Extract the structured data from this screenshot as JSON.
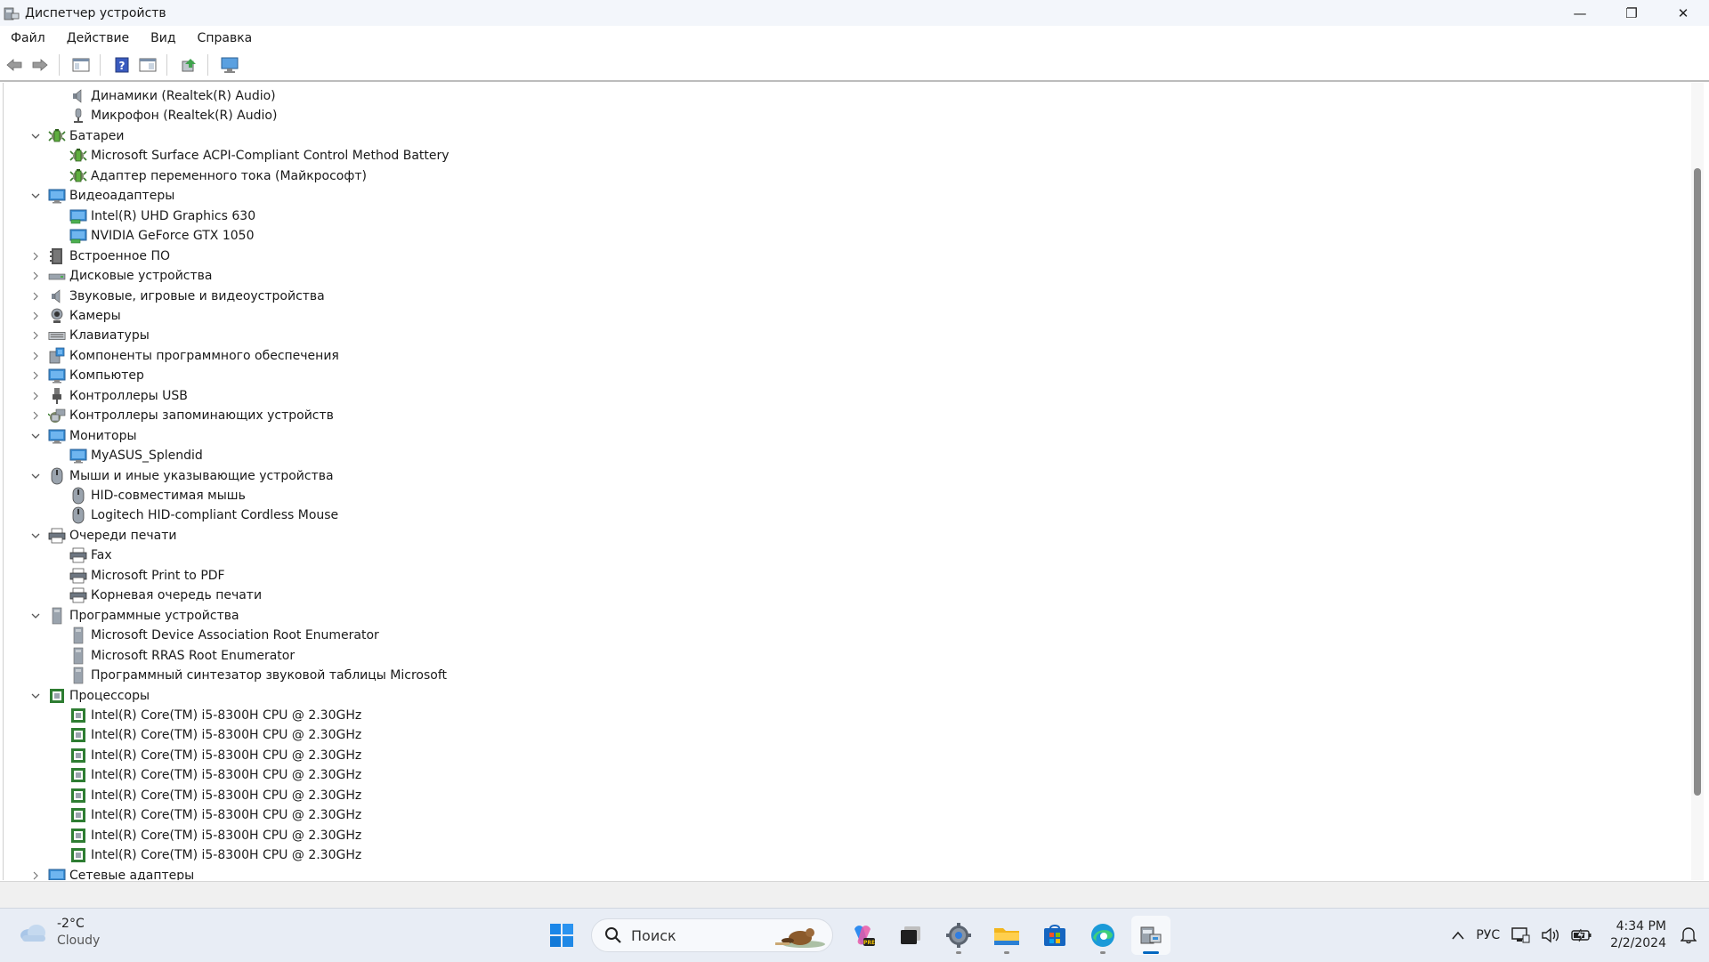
{
  "window": {
    "title": "Диспетчер устройств",
    "controls": {
      "minimize": "—",
      "maximize": "❐",
      "close": "✕"
    }
  },
  "menu": [
    "Файл",
    "Действие",
    "Вид",
    "Справка"
  ],
  "tree": [
    {
      "label": "Динамики (Realtek(R) Audio)",
      "level": 2,
      "icon": "speaker"
    },
    {
      "label": "Микрофон (Realtek(R) Audio)",
      "level": 2,
      "icon": "microphone"
    },
    {
      "label": "Батареи",
      "level": 1,
      "icon": "battery",
      "expanded": true
    },
    {
      "label": "Microsoft Surface ACPI-Compliant Control Method Battery",
      "level": 2,
      "icon": "battery"
    },
    {
      "label": "Адаптер переменного тока (Майкрософт)",
      "level": 2,
      "icon": "battery"
    },
    {
      "label": "Видеоадаптеры",
      "level": 1,
      "icon": "monitor",
      "expanded": true
    },
    {
      "label": "Intel(R) UHD Graphics 630",
      "level": 2,
      "icon": "display-adapter"
    },
    {
      "label": "NVIDIA GeForce GTX 1050",
      "level": 2,
      "icon": "display-adapter"
    },
    {
      "label": "Встроенное ПО",
      "level": 1,
      "icon": "firmware",
      "expanded": false
    },
    {
      "label": "Дисковые устройства",
      "level": 1,
      "icon": "disk",
      "expanded": false
    },
    {
      "label": "Звуковые, игровые и видеоустройства",
      "level": 1,
      "icon": "speaker",
      "expanded": false
    },
    {
      "label": "Камеры",
      "level": 1,
      "icon": "camera",
      "expanded": false
    },
    {
      "label": "Клавиатуры",
      "level": 1,
      "icon": "keyboard",
      "expanded": false
    },
    {
      "label": "Компоненты программного обеспечения",
      "level": 1,
      "icon": "software",
      "expanded": false
    },
    {
      "label": "Компьютер",
      "level": 1,
      "icon": "monitor",
      "expanded": false
    },
    {
      "label": "Контроллеры USB",
      "level": 1,
      "icon": "usb",
      "expanded": false
    },
    {
      "label": "Контроллеры запоминающих устройств",
      "level": 1,
      "icon": "storage",
      "expanded": false
    },
    {
      "label": "Мониторы",
      "level": 1,
      "icon": "monitor",
      "expanded": true
    },
    {
      "label": "MyASUS_Splendid",
      "level": 2,
      "icon": "monitor"
    },
    {
      "label": "Мыши и иные указывающие устройства",
      "level": 1,
      "icon": "mouse",
      "expanded": true
    },
    {
      "label": "HID-совместимая мышь",
      "level": 2,
      "icon": "mouse"
    },
    {
      "label": "Logitech HID-compliant Cordless Mouse",
      "level": 2,
      "icon": "mouse"
    },
    {
      "label": "Очереди печати",
      "level": 1,
      "icon": "printer",
      "expanded": true
    },
    {
      "label": "Fax",
      "level": 2,
      "icon": "printer"
    },
    {
      "label": "Microsoft Print to PDF",
      "level": 2,
      "icon": "printer"
    },
    {
      "label": "Корневая очередь печати",
      "level": 2,
      "icon": "printer"
    },
    {
      "label": "Программные устройства",
      "level": 1,
      "icon": "software-device",
      "expanded": true
    },
    {
      "label": "Microsoft Device Association Root Enumerator",
      "level": 2,
      "icon": "software-device"
    },
    {
      "label": "Microsoft RRAS Root Enumerator",
      "level": 2,
      "icon": "software-device"
    },
    {
      "label": "Программный синтезатор звуковой таблицы Microsoft",
      "level": 2,
      "icon": "software-device"
    },
    {
      "label": "Процессоры",
      "level": 1,
      "icon": "cpu",
      "expanded": true
    },
    {
      "label": "Intel(R) Core(TM) i5-8300H CPU @ 2.30GHz",
      "level": 2,
      "icon": "cpu"
    },
    {
      "label": "Intel(R) Core(TM) i5-8300H CPU @ 2.30GHz",
      "level": 2,
      "icon": "cpu"
    },
    {
      "label": "Intel(R) Core(TM) i5-8300H CPU @ 2.30GHz",
      "level": 2,
      "icon": "cpu"
    },
    {
      "label": "Intel(R) Core(TM) i5-8300H CPU @ 2.30GHz",
      "level": 2,
      "icon": "cpu"
    },
    {
      "label": "Intel(R) Core(TM) i5-8300H CPU @ 2.30GHz",
      "level": 2,
      "icon": "cpu"
    },
    {
      "label": "Intel(R) Core(TM) i5-8300H CPU @ 2.30GHz",
      "level": 2,
      "icon": "cpu"
    },
    {
      "label": "Intel(R) Core(TM) i5-8300H CPU @ 2.30GHz",
      "level": 2,
      "icon": "cpu"
    },
    {
      "label": "Intel(R) Core(TM) i5-8300H CPU @ 2.30GHz",
      "level": 2,
      "icon": "cpu"
    },
    {
      "label": "Сетевые адаптеры",
      "level": 1,
      "icon": "network",
      "expanded": false
    }
  ],
  "taskbar": {
    "weather": {
      "temp": "-2°C",
      "desc": "Cloudy"
    },
    "search_placeholder": "Поиск",
    "apps": [
      "start",
      "search",
      "copilot",
      "task-view",
      "settings",
      "file-explorer",
      "microsoft-store",
      "edge",
      "device-manager"
    ],
    "tray": {
      "language": "РУС",
      "time": "4:34 PM",
      "date": "2/2/2024"
    }
  },
  "colors": {
    "accent": "#0067c0",
    "cpu_green": "#2e7d32",
    "monitor_blue": "#3b8fd6"
  }
}
